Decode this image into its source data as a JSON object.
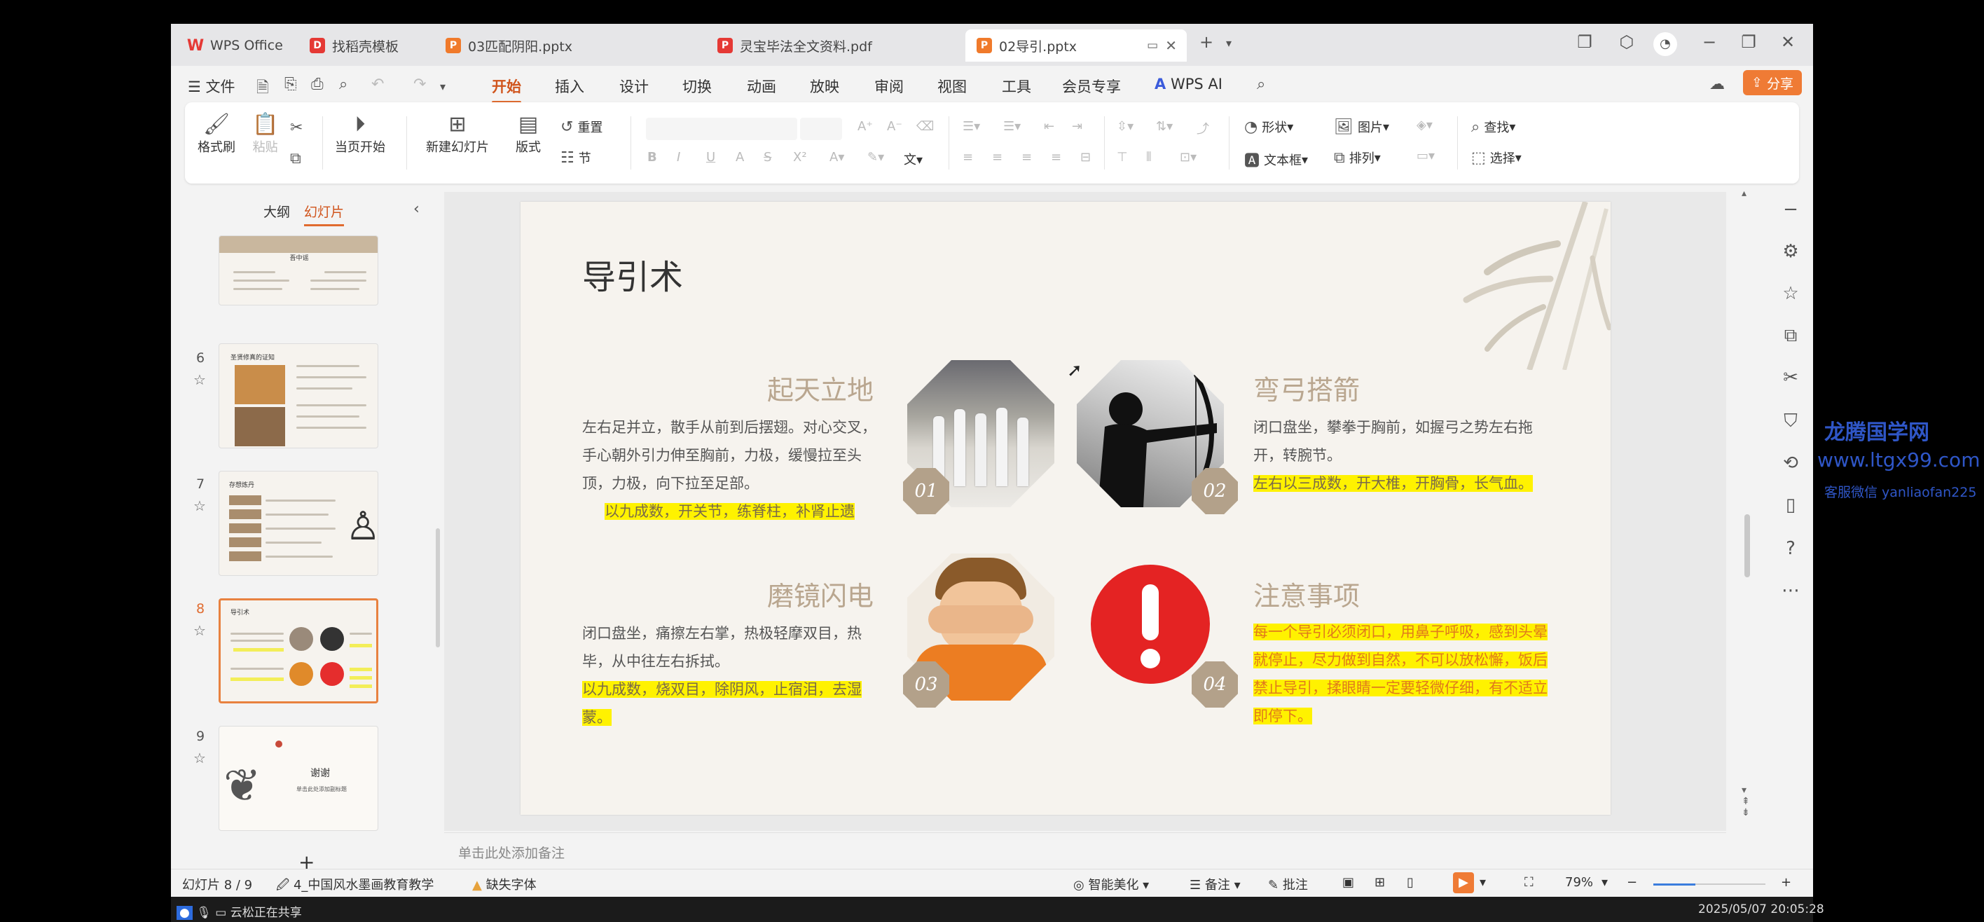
{
  "tabs": [
    {
      "label": "WPS Office",
      "icon": "wps-logo-icon",
      "color": "#e53935"
    },
    {
      "label": "找稻壳模板",
      "icon": "docer-icon",
      "color": "#e53935"
    },
    {
      "label": "03匹配阴阳.pptx",
      "icon": "ppt-icon",
      "color": "#f07a2b"
    },
    {
      "label": "灵宝毕法全文资料.pdf",
      "icon": "pdf-icon",
      "color": "#e53935"
    },
    {
      "label": "02导引.pptx",
      "icon": "ppt-icon",
      "color": "#f07a2b"
    }
  ],
  "menu": [
    "文件",
    "开始",
    "插入",
    "设计",
    "切换",
    "动画",
    "放映",
    "审阅",
    "视图",
    "工具",
    "会员专享",
    "WPS AI"
  ],
  "share_label": "分享",
  "ribbon": {
    "format_painter": "格式刷",
    "paste": "粘贴",
    "from_current": "当页开始",
    "new_slide": "新建幻灯片",
    "layout": "版式",
    "reset": "重置",
    "section": "节",
    "shape": "形状",
    "picture": "图片",
    "textbox": "文本框",
    "arrange": "排列",
    "find": "查找",
    "select": "选择"
  },
  "panel": {
    "outline_tab": "大纲",
    "slides_tab": "幻灯片",
    "add": "+"
  },
  "thumbs": [
    {
      "num": "",
      "title": "吾中谣"
    },
    {
      "num": "6",
      "title": "圣贤修真的证知"
    },
    {
      "num": "7",
      "title": "存想炼丹"
    },
    {
      "num": "8",
      "title": "导引术"
    },
    {
      "num": "9",
      "title": "谢谢",
      "subtitle": "单击此处添加副标题"
    }
  ],
  "slide": {
    "title": "导引术",
    "sections": [
      {
        "title": "起天立地",
        "body": "左右足并立，散手从前到后摆翅。对心交叉，手心朝外引力伸至胸前，力极，缓慢拉至头顶，力极，向下拉至足部。",
        "highlight": "以九成数，开关节，练脊柱，补肾止遗",
        "badge": "01"
      },
      {
        "title": "弯弓搭箭",
        "body": "闭口盘坐，攀拳于胸前，如握弓之势左右拖开，转腕节。",
        "highlight": "左右以三成数，开大椎，开胸骨，长气血。",
        "badge": "02"
      },
      {
        "title": "磨镜闪电",
        "body": "闭口盘坐，痛擦左右掌，热极轻摩双目，热毕，从中往左右拆拭。",
        "highlight": "以九成数，烧双目，除阴风，止宿泪，去湿蒙。",
        "badge": "03"
      },
      {
        "title": "注意事项",
        "highlight": "每一个导引必须闭口，用鼻子呼吸，感到头晕就停止，尽力做到自然，不可以放松懈，饭后禁止导引，揉眼睛一定要轻微仔细，有不适立即停下。",
        "badge": "04"
      }
    ]
  },
  "notes_placeholder": "单击此处添加备注",
  "status": {
    "slide_count": "幻灯片 8 / 9",
    "theme": "4_中国风水墨画教育教学",
    "missing_font": "缺失字体",
    "beautify": "智能美化",
    "notes": "备注",
    "comments": "批注",
    "zoom": "79%"
  },
  "sharebar": {
    "label": "云松正在共享",
    "datetime": "2025/05/07 20:05:28"
  },
  "watermark": {
    "line1": "龙腾国学网",
    "line2": "www.ltgx99.com",
    "line3": "客服微信 yanliaofan225"
  },
  "colors": {
    "accent": "#e06b2f",
    "highlight": "#fff200",
    "badge": "#b3a18a",
    "section_title": "#b9a68f"
  }
}
